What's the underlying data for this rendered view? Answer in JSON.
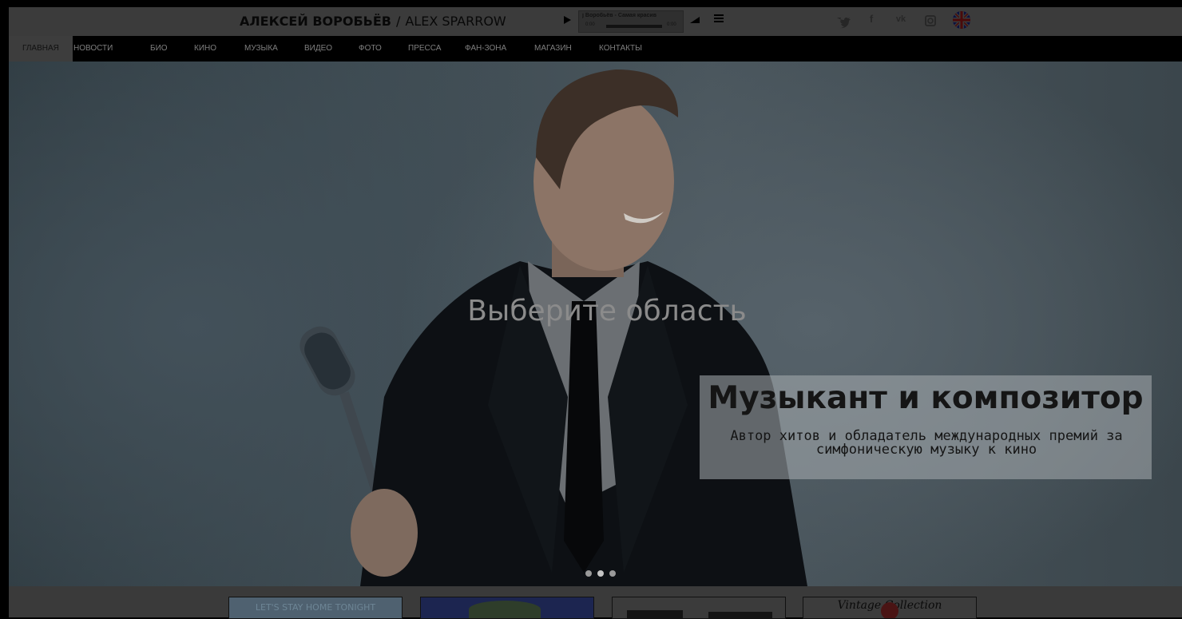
{
  "header": {
    "brand_ru": "АЛЕКСЕЙ ВОРОБЬЁВ",
    "brand_sep": "/",
    "brand_en": "ALEX SPARROW"
  },
  "player": {
    "track_title": "ј Воробьёв - Самая красив",
    "time_current": "0:00",
    "time_total": "0:00",
    "progress": 0
  },
  "social": [
    {
      "icon": "twitter-icon",
      "glyph": "t"
    },
    {
      "icon": "facebook-icon",
      "glyph": "f"
    },
    {
      "icon": "vk-icon",
      "glyph": "vk"
    },
    {
      "icon": "instagram-icon",
      "glyph": "◙"
    }
  ],
  "language_flag": "uk-flag-icon",
  "nav": {
    "items": [
      {
        "label": "ГЛАВНАЯ",
        "active": true
      },
      {
        "label": "НОВОСТИ",
        "active": false
      },
      {
        "label": "БИО",
        "active": false
      },
      {
        "label": "КИНО",
        "active": false
      },
      {
        "label": "МУЗЫКА",
        "active": false
      },
      {
        "label": "ВИДЕО",
        "active": false
      },
      {
        "label": "ФОТО",
        "active": false
      },
      {
        "label": "ПРЕССА",
        "active": false
      },
      {
        "label": "ФАН-ЗОНА",
        "active": false
      },
      {
        "label": "МАГАЗИН",
        "active": false
      },
      {
        "label": "КОНТАКТЫ",
        "active": false
      }
    ]
  },
  "hero": {
    "overlay_prompt": "Выберите область",
    "caption_title": "Музыкант и композитор",
    "caption_subtitle": "Автор хитов и обладатель международных премий за симфоническую музыку к кино",
    "slide_count": 3,
    "active_slide": 2
  },
  "promo_cards": [
    {
      "label": "LET'S STAY HOME TONIGHT",
      "color": "#a9c3d3"
    },
    {
      "label": "",
      "color": "#3b4f9a"
    },
    {
      "label": "",
      "color": "#d9d9d9"
    },
    {
      "label": "Vintage Collection",
      "color": "#1a1a1a"
    }
  ],
  "colors": {
    "accent_nav_active": "#3d3d3d",
    "dim_overlay": "#000000"
  }
}
